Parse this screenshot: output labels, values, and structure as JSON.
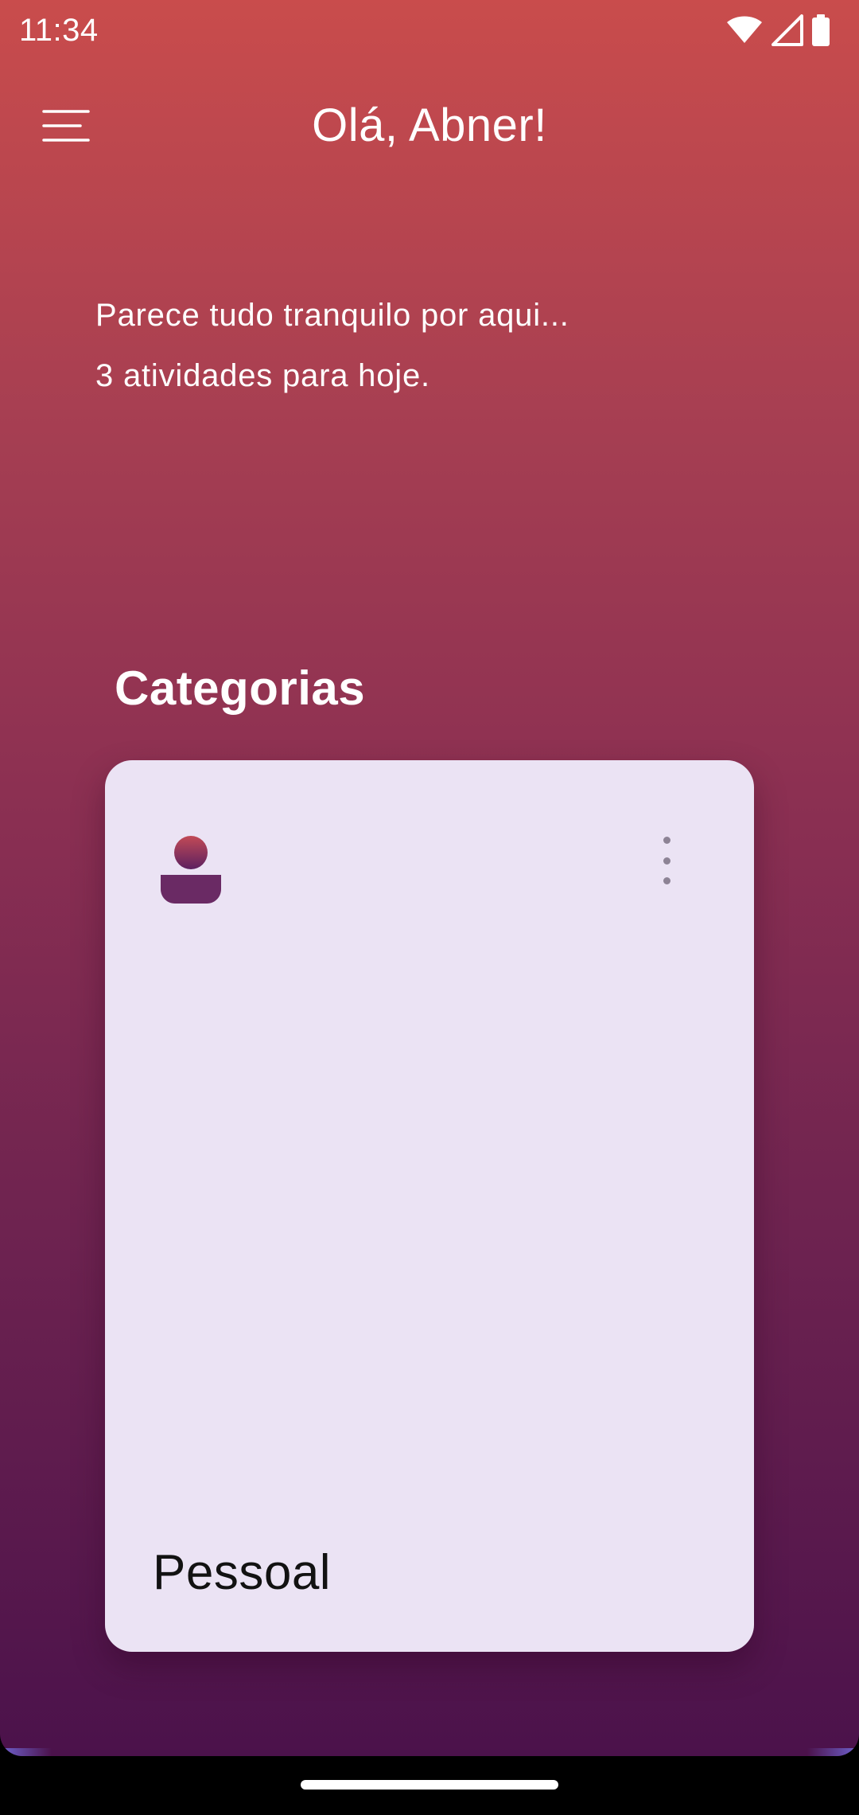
{
  "status_bar": {
    "time": "11:34",
    "icons": [
      "wifi-icon",
      "cell-signal-icon",
      "battery-icon"
    ]
  },
  "header": {
    "greeting": "Olá, Abner!",
    "menu_icon": "menu-icon"
  },
  "summary": {
    "line1": "Parece tudo tranquilo por aqui...",
    "line2": "3 atividades para hoje."
  },
  "categories": {
    "title": "Categorias",
    "items": [
      {
        "label": "Pessoal",
        "icon": "person-icon"
      }
    ]
  },
  "colors": {
    "gradient_top": "#c94c4c",
    "gradient_bottom": "#4b124b",
    "card_bg": "#ebe3f4",
    "text_primary": "#ffffff"
  }
}
